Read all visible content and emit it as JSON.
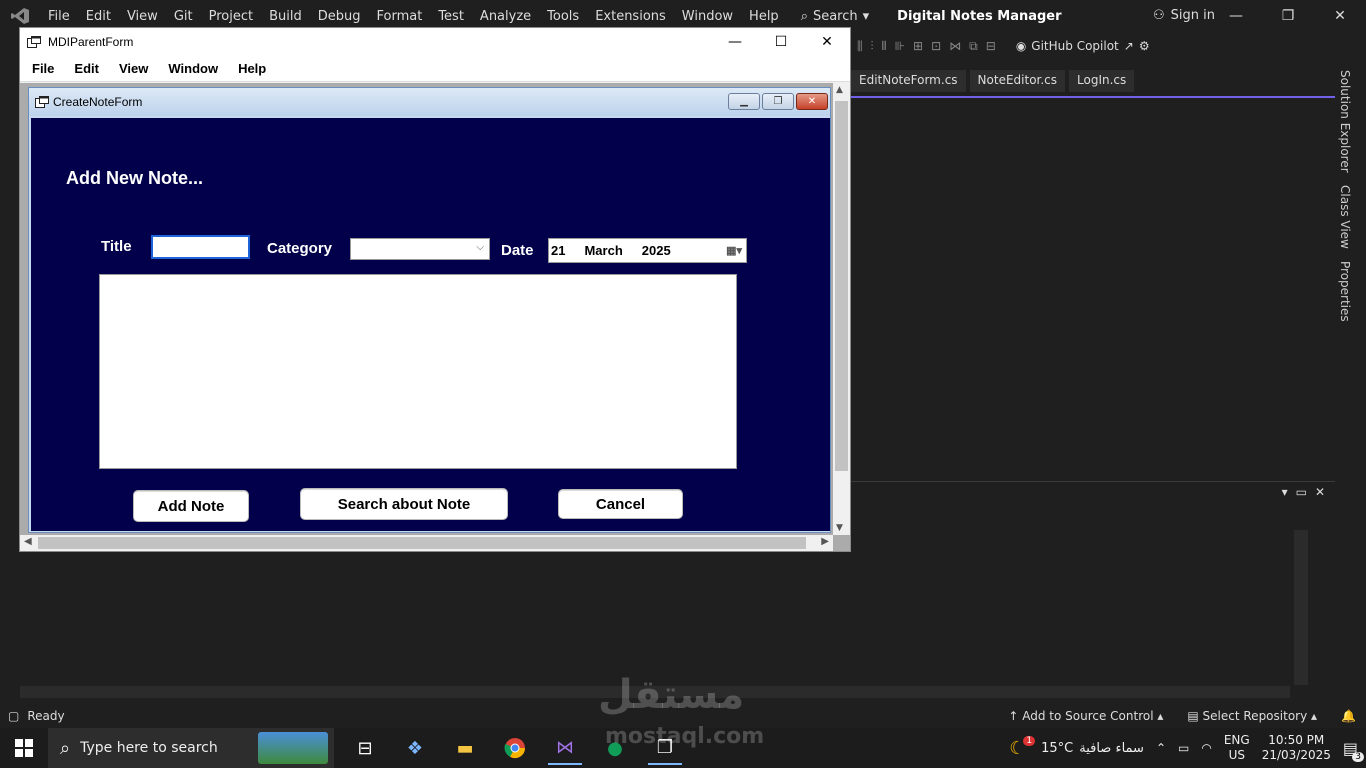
{
  "vs": {
    "menu": [
      "File",
      "Edit",
      "View",
      "Git",
      "Project",
      "Build",
      "Debug",
      "Format",
      "Test",
      "Analyze",
      "Tools",
      "Extensions",
      "Window",
      "Help"
    ],
    "search_label": "Search",
    "app_title": "Digital Notes Manager",
    "signin": "Sign in",
    "copilot": "GitHub Copilot",
    "tabs": [
      "EditNoteForm.cs",
      "NoteEditor.cs",
      "LogIn.cs"
    ],
    "side_tabs": [
      "Solution Explorer",
      "Class View",
      "Properties"
    ],
    "status_ready": "Ready",
    "status_source_control": "Add to Source Control",
    "status_repo": "Select Repository",
    "notification_count": "1"
  },
  "mdi": {
    "title": "MDIParentForm",
    "menu": [
      "File",
      "Edit",
      "View",
      "Window",
      "Help"
    ]
  },
  "child": {
    "title": "CreateNoteForm",
    "heading": "Add New Note...",
    "title_label": "Title",
    "category_label": "Category",
    "date_label": "Date",
    "title_value": "",
    "category_value": "",
    "date": {
      "day": "21",
      "month": "March",
      "year": "2025"
    },
    "note_text": "",
    "add_button": "Add  Note",
    "search_button": "Search about Note",
    "cancel_button": "Cancel"
  },
  "taskbar": {
    "search_placeholder": "Type here to search",
    "temperature": "15°C",
    "weather_text": "سماء صافية",
    "lang_line1": "ENG",
    "lang_line2": "US",
    "time": "10:50 PM",
    "date": "21/03/2025",
    "notif_badge": "3",
    "weather_badge": "1"
  },
  "watermark": {
    "main": "مستقل",
    "sub": "mostaql.com"
  },
  "colors": {
    "form_bg": "#02004a",
    "vs_accent": "#7160e8"
  }
}
